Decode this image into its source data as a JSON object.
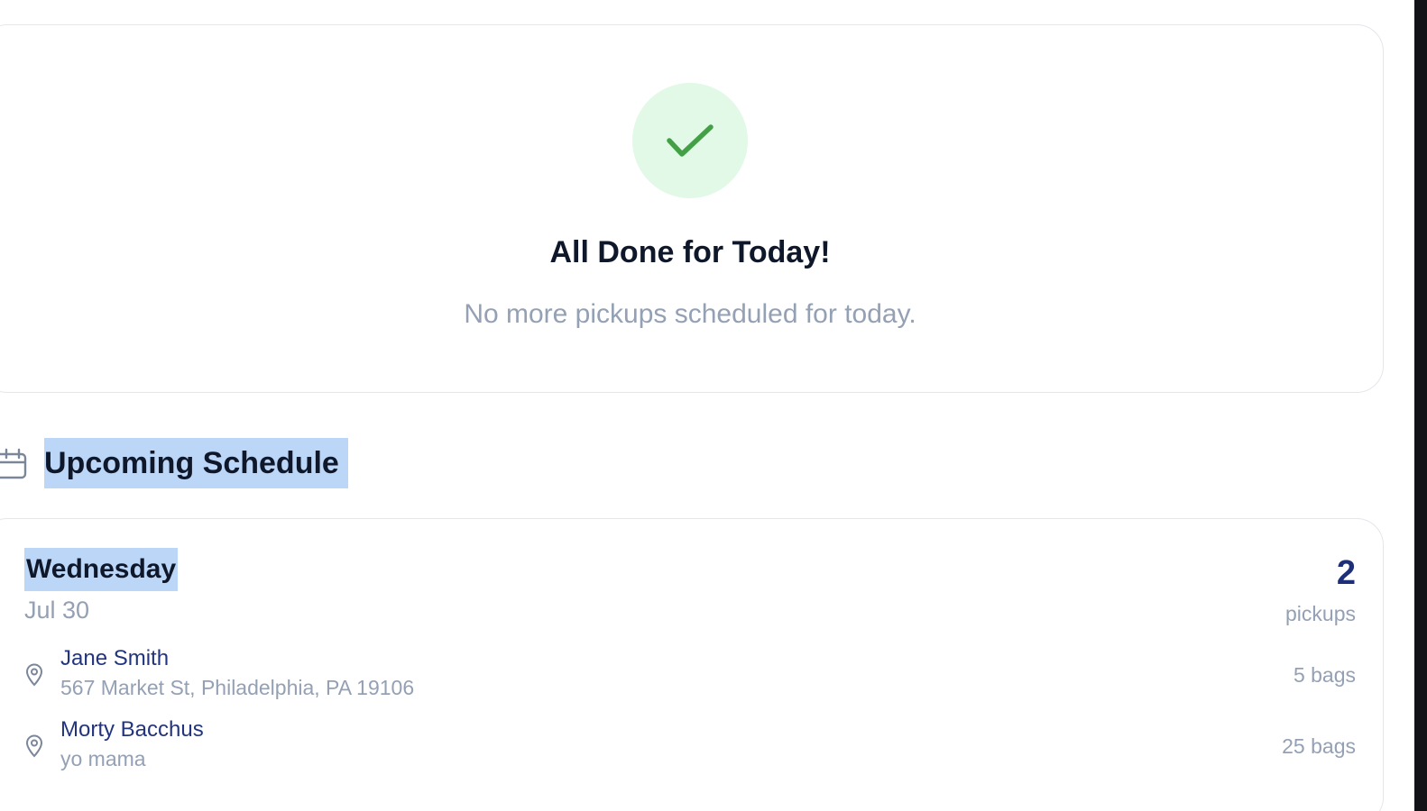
{
  "summary": {
    "icon": "check-icon",
    "title": "All Done for Today!",
    "subtitle": "No more pickups scheduled for today."
  },
  "schedule": {
    "icon": "calendar-icon",
    "heading": "Upcoming Schedule",
    "days": [
      {
        "day": "Wednesday",
        "date": "Jul 30",
        "count": "2",
        "count_label": "pickups",
        "pickups": [
          {
            "name": "Jane Smith",
            "address": "567 Market St, Philadelphia, PA 19106",
            "bags": "5 bags"
          },
          {
            "name": "Morty Bacchus",
            "address": "yo mama",
            "bags": "25 bags"
          }
        ]
      }
    ]
  },
  "colors": {
    "accent": "#1e2f7a",
    "success": "#43a047",
    "success_bg": "#e1f9e6",
    "selection": "#bcd6f7",
    "muted": "#94a0b4"
  }
}
